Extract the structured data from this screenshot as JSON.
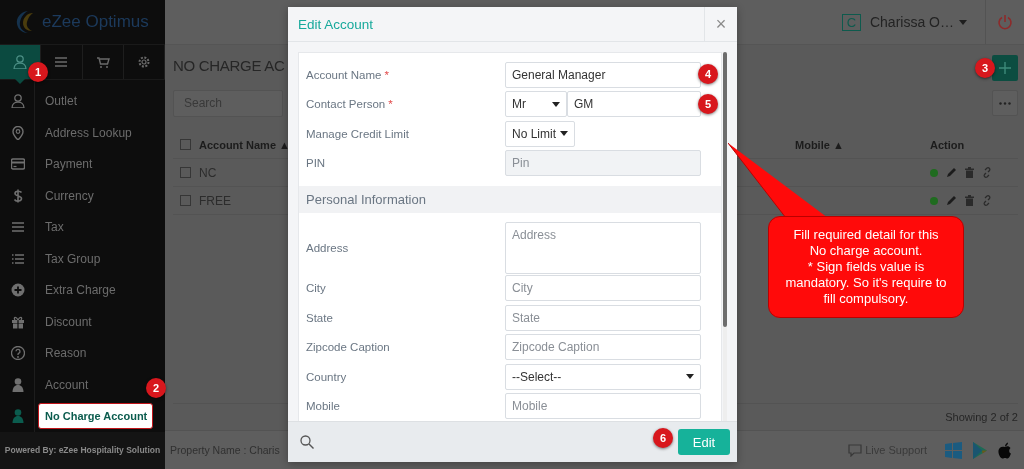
{
  "sidebar": {
    "logo": "eZee Optimus",
    "tabs": [
      {
        "selected": true
      },
      {
        "selected": false
      },
      {
        "selected": false
      },
      {
        "selected": false
      }
    ],
    "items": [
      {
        "label": "Outlet",
        "selected": false,
        "outlined": false
      },
      {
        "label": "Address Lookup",
        "selected": false,
        "outlined": false
      },
      {
        "label": "Payment",
        "selected": false,
        "outlined": false
      },
      {
        "label": "Currency",
        "selected": false,
        "outlined": false
      },
      {
        "label": "Tax",
        "selected": false,
        "outlined": false
      },
      {
        "label": "Tax Group",
        "selected": false,
        "outlined": false
      },
      {
        "label": "Extra Charge",
        "selected": false,
        "outlined": false
      },
      {
        "label": "Discount",
        "selected": false,
        "outlined": false
      },
      {
        "label": "Reason",
        "selected": false,
        "outlined": false
      },
      {
        "label": "Account",
        "selected": false,
        "outlined": false
      },
      {
        "label": "No Charge Account",
        "selected": true,
        "outlined": true
      }
    ],
    "footer": "Powered By: eZee Hospitality Solution"
  },
  "top_bar": {
    "avatar": "C",
    "user": "Charissa O…"
  },
  "page": {
    "title": "NO CHARGE AC",
    "search": {
      "placeholder": "Search"
    },
    "table": {
      "select_all": {
        "checked": false
      },
      "columns": [
        {
          "label": "Account Name",
          "sort": "▲"
        },
        {
          "label": "Mobile",
          "sort": "▲"
        },
        {
          "label": "Action"
        }
      ],
      "rows": [
        {
          "account_name": "NC",
          "checked": false,
          "active": true
        },
        {
          "account_name": "FREE",
          "checked": false,
          "active": true
        }
      ]
    },
    "status": "Showing 2 of 2"
  },
  "footer": {
    "property": "Property Name : Charis",
    "support": "Live Support"
  },
  "modal": {
    "title": "Edit Account",
    "close": "×",
    "rows": [
      {
        "kind": "text",
        "label": "Account Name",
        "required_mark": "*",
        "value": "General Manager"
      },
      {
        "kind": "name",
        "label": "Contact Person",
        "required_mark": "*",
        "title": "Mr",
        "value": "GM"
      },
      {
        "kind": "select",
        "label": "Manage Credit Limit",
        "value": "No Limit"
      },
      {
        "kind": "locked",
        "label": "PIN",
        "placeholder": "Pin"
      },
      {
        "kind": "section",
        "label": "Personal Information"
      },
      {
        "kind": "textarea",
        "label": "Address",
        "placeholder": "Address"
      },
      {
        "kind": "text",
        "label": "City",
        "placeholder": "City"
      },
      {
        "kind": "text",
        "label": "State",
        "placeholder": "State"
      },
      {
        "kind": "text",
        "label": "Zipcode Caption",
        "placeholder": "Zipcode Caption"
      },
      {
        "kind": "wide-select",
        "label": "Country",
        "value": "--Select--"
      },
      {
        "kind": "text",
        "label": "Mobile",
        "placeholder": "Mobile"
      }
    ],
    "button": "Edit"
  },
  "annotations": {
    "badges": [
      "1",
      "2",
      "3",
      "4",
      "5",
      "6"
    ],
    "callout": "Fill required detail for this No charge account.\n* Sign fields value is mandatory. So it's require to fill compulsory."
  }
}
